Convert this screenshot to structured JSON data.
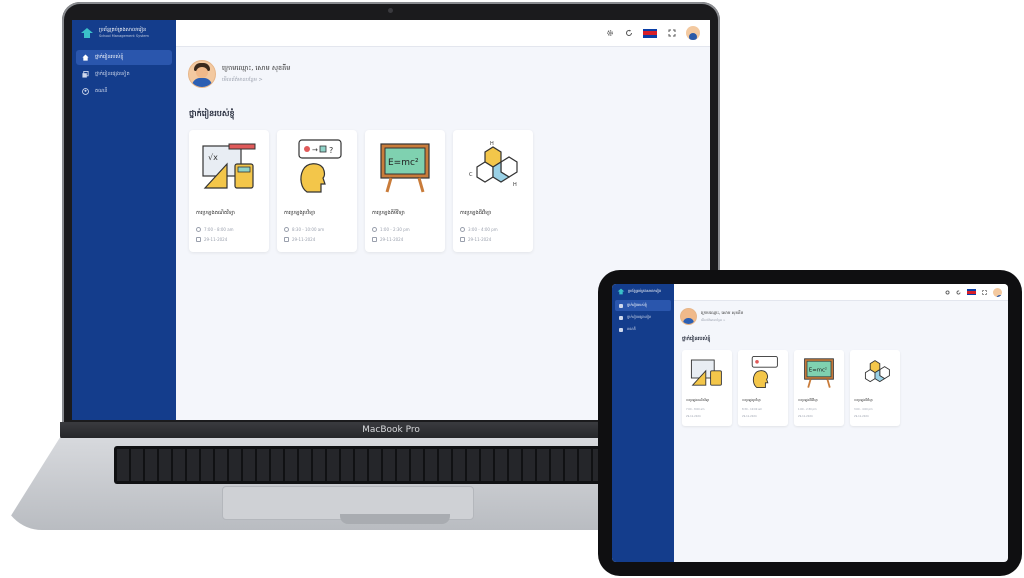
{
  "laptop": {
    "model_label": "MacBook Pro"
  },
  "app": {
    "logo_title": "ប្រព័ន្ធគ្រប់គ្រងសាលារៀន",
    "logo_subtitle": "School Management System",
    "sidebar": {
      "items": [
        {
          "label": "ថ្នាក់រៀនរបស់ខ្ញុំ",
          "icon": "home-icon",
          "active": true
        },
        {
          "label": "ថ្នាក់រៀនផ្សេងទៀត",
          "icon": "copy-icon",
          "active": false
        },
        {
          "label": "គណនី",
          "icon": "user-circle-icon",
          "active": false
        }
      ]
    },
    "topbar": {
      "icons": [
        "settings-icon",
        "refresh-icon",
        "cambodia-flag-icon",
        "fullscreen-icon",
        "avatar"
      ]
    },
    "profile": {
      "name": "ក្រោមឈ្មោះ, សោម សុខគីម",
      "link": "មើលព័ត៌មានបន្ថែម >"
    },
    "section_title": "ថ្នាក់រៀនរបស់ខ្ញុំ",
    "classes": [
      {
        "title": "ការប្រឡងគណិតវិទ្យា",
        "time": "7:00 - 8:00 am",
        "date": "29-11-2024",
        "illustration": "math-tools"
      },
      {
        "title": "ការប្រឡងរូបវិទ្យា",
        "time": "8:30 - 10:00 am",
        "date": "29-11-2024",
        "illustration": "thinking-head"
      },
      {
        "title": "ការប្រឡងគីមីវិទ្យា",
        "time": "1:00 - 2:30 pm",
        "date": "29-11-2024",
        "illustration": "blackboard-emc2"
      },
      {
        "title": "ការប្រឡងជីវវិទ្យា",
        "time": "3:00 - 4:00 pm",
        "date": "29-11-2024",
        "illustration": "molecule"
      }
    ]
  },
  "colors": {
    "sidebar": "#143d8c",
    "sidebar_active": "#2a56ad",
    "background": "#f4f6fb"
  }
}
